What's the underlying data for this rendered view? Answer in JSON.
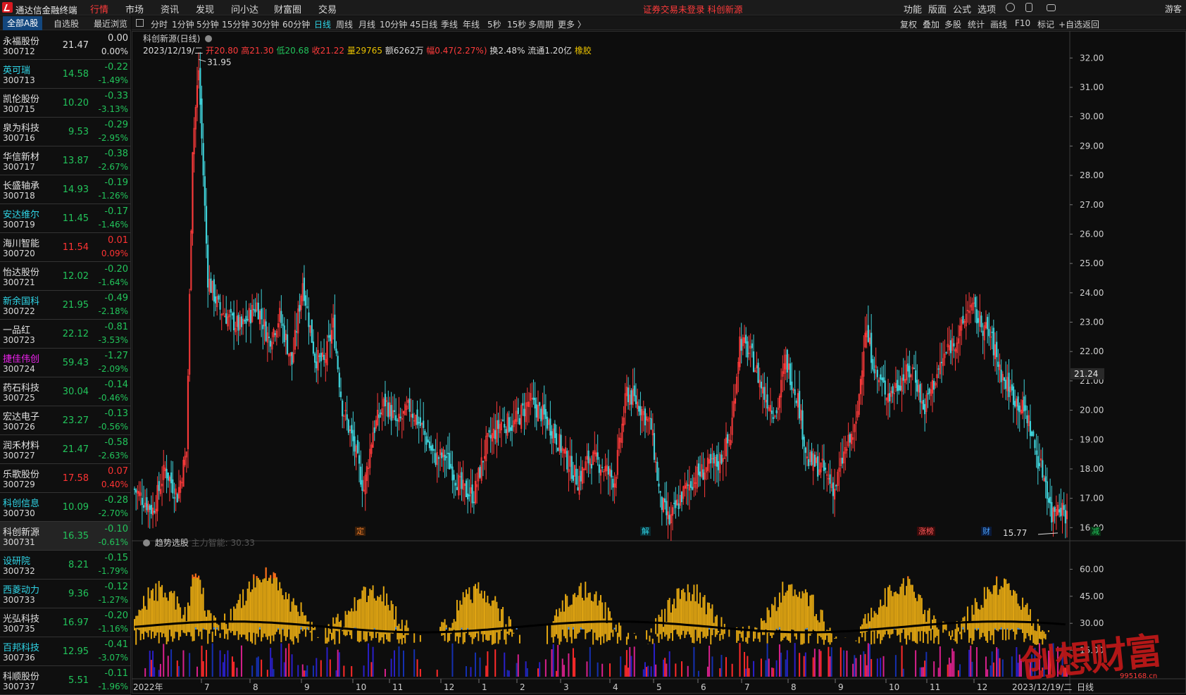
{
  "app": {
    "title": "通达信金融终端",
    "guest": "游客"
  },
  "top_menu": [
    "行情",
    "市场",
    "资讯",
    "发现",
    "问小达",
    "财富圈",
    "交易"
  ],
  "status_text": "证券交易未登录  科创新源",
  "right_menu": [
    "功能",
    "版面",
    "公式",
    "选项"
  ],
  "left_tabs": [
    "全部A股",
    "自选股",
    "最近浏览"
  ],
  "stocks": [
    {
      "name": "永福股份",
      "code": "300712",
      "price": "21.47",
      "chg": "0.00",
      "pct": "0.00%",
      "dir": "fl",
      "name_color": "w"
    },
    {
      "name": "英可瑞",
      "code": "300713",
      "price": "14.58",
      "chg": "-0.22",
      "pct": "-1.49%",
      "dir": "dn",
      "name_color": "cyan"
    },
    {
      "name": "凯伦股份",
      "code": "300715",
      "price": "10.20",
      "chg": "-0.33",
      "pct": "-3.13%",
      "dir": "dn",
      "name_color": "w"
    },
    {
      "name": "泉为科技",
      "code": "300716",
      "price": "9.53",
      "chg": "-0.29",
      "pct": "-2.95%",
      "dir": "dn",
      "name_color": "w"
    },
    {
      "name": "华信新材",
      "code": "300717",
      "price": "13.87",
      "chg": "-0.38",
      "pct": "-2.67%",
      "dir": "dn",
      "name_color": "w"
    },
    {
      "name": "长盛轴承",
      "code": "300718",
      "price": "14.93",
      "chg": "-0.19",
      "pct": "-1.26%",
      "dir": "dn",
      "name_color": "w"
    },
    {
      "name": "安达维尔",
      "code": "300719",
      "price": "11.45",
      "chg": "-0.17",
      "pct": "-1.46%",
      "dir": "dn",
      "name_color": "cyan"
    },
    {
      "name": "海川智能",
      "code": "300720",
      "price": "11.54",
      "chg": "0.01",
      "pct": "0.09%",
      "dir": "up",
      "name_color": "w"
    },
    {
      "name": "怡达股份",
      "code": "300721",
      "price": "12.02",
      "chg": "-0.20",
      "pct": "-1.64%",
      "dir": "dn",
      "name_color": "w"
    },
    {
      "name": "新余国科",
      "code": "300722",
      "price": "21.95",
      "chg": "-0.49",
      "pct": "-2.18%",
      "dir": "dn",
      "name_color": "cyan"
    },
    {
      "name": "一品红",
      "code": "300723",
      "price": "22.12",
      "chg": "-0.81",
      "pct": "-3.53%",
      "dir": "dn",
      "name_color": "w"
    },
    {
      "name": "捷佳伟创",
      "code": "300724",
      "price": "59.43",
      "chg": "-1.27",
      "pct": "-2.09%",
      "dir": "dn",
      "name_color": "mag"
    },
    {
      "name": "药石科技",
      "code": "300725",
      "price": "30.04",
      "chg": "-0.14",
      "pct": "-0.46%",
      "dir": "dn",
      "name_color": "w"
    },
    {
      "name": "宏达电子",
      "code": "300726",
      "price": "23.27",
      "chg": "-0.13",
      "pct": "-0.56%",
      "dir": "dn",
      "name_color": "w"
    },
    {
      "name": "润禾材料",
      "code": "300727",
      "price": "21.47",
      "chg": "-0.58",
      "pct": "-2.63%",
      "dir": "dn",
      "name_color": "w"
    },
    {
      "name": "乐歌股份",
      "code": "300729",
      "price": "17.58",
      "chg": "0.07",
      "pct": "0.40%",
      "dir": "up",
      "name_color": "w"
    },
    {
      "name": "科创信息",
      "code": "300730",
      "price": "10.09",
      "chg": "-0.28",
      "pct": "-2.70%",
      "dir": "dn",
      "name_color": "cyan"
    },
    {
      "name": "科创新源",
      "code": "300731",
      "price": "16.35",
      "chg": "-0.10",
      "pct": "-0.61%",
      "dir": "dn",
      "name_color": "w"
    },
    {
      "name": "设研院",
      "code": "300732",
      "price": "8.21",
      "chg": "-0.15",
      "pct": "-1.79%",
      "dir": "dn",
      "name_color": "cyan"
    },
    {
      "name": "西菱动力",
      "code": "300733",
      "price": "9.36",
      "chg": "-0.12",
      "pct": "-1.27%",
      "dir": "dn",
      "name_color": "cyan"
    },
    {
      "name": "光弘科技",
      "code": "300735",
      "price": "16.97",
      "chg": "-0.20",
      "pct": "-1.16%",
      "dir": "dn",
      "name_color": "w"
    },
    {
      "name": "百邦科技",
      "code": "300736",
      "price": "12.95",
      "chg": "-0.41",
      "pct": "-3.07%",
      "dir": "dn",
      "name_color": "cyan"
    },
    {
      "name": "科顺股份",
      "code": "300737",
      "price": "5.51",
      "chg": "-0.11",
      "pct": "-1.96%",
      "dir": "dn",
      "name_color": "w"
    }
  ],
  "period_items": [
    "分时",
    "1分钟",
    "5分钟",
    "15分钟",
    "30分钟",
    "60分钟",
    "日线",
    "周线",
    "月线",
    "10分钟",
    "45日线",
    "季线",
    "年线",
    "5秒",
    "15秒",
    "多周期",
    "更多 〉"
  ],
  "period_active": "日线",
  "right_tools": [
    "复权",
    "叠加",
    "多股",
    "统计",
    "画线",
    "F10",
    "标记",
    "+自选",
    "返回"
  ],
  "chart_header": {
    "title": "科创新源(日线)",
    "date": "2023/12/19/二",
    "open_label": "开",
    "open": "20.80",
    "high_label": "高",
    "high": "21.30",
    "low_label": "低",
    "low": "20.68",
    "close_label": "收",
    "close": "21.22",
    "vol_label": "量",
    "vol": "29765",
    "amt_label": "额",
    "amt": "6262万",
    "range_label": "幅",
    "range": "0.47(2.27%)",
    "turn_label": "换",
    "turn": "2.48%",
    "float_label": "流通",
    "float": "1.20亿",
    "sector": "橡胶"
  },
  "indicator": {
    "title": "趋势选股",
    "subtitle": "主力智能: 30.33"
  },
  "chart_data": {
    "type": "candlestick",
    "title": "科创新源(日线)",
    "y_ticks": [
      "32.00",
      "31.00",
      "30.00",
      "29.00",
      "28.00",
      "27.00",
      "26.00",
      "25.00",
      "24.00",
      "23.00",
      "22.00",
      "21.00",
      "20.00",
      "19.00",
      "18.00",
      "17.00",
      "16.00"
    ],
    "ylim": [
      15.6,
      32.2
    ],
    "current_price": "21.24",
    "max_label": "31.95",
    "min_label": "15.77",
    "x_labels": [
      "2022年",
      "7",
      "8",
      "9",
      "10",
      "11",
      "12",
      "1",
      "2",
      "3",
      "4",
      "5",
      "6",
      "7",
      "8",
      "9",
      "10",
      "11",
      "12",
      "2023/12/19/二"
    ],
    "x_label_right": "日线",
    "event_markers": [
      "定",
      "解",
      "涨榜",
      "财",
      "减"
    ],
    "close_path": [
      [
        0,
        17.3
      ],
      [
        12,
        16.6
      ],
      [
        20,
        18.0
      ],
      [
        28,
        17.1
      ],
      [
        34,
        18.6
      ],
      [
        38,
        29.0
      ],
      [
        42,
        31.6
      ],
      [
        48,
        24.5
      ],
      [
        55,
        23.5
      ],
      [
        62,
        23.1
      ],
      [
        70,
        22.8
      ],
      [
        80,
        23.6
      ],
      [
        88,
        22.4
      ],
      [
        95,
        23.2
      ],
      [
        103,
        21.6
      ],
      [
        110,
        24.4
      ],
      [
        118,
        21.8
      ],
      [
        124,
        21.6
      ],
      [
        130,
        22.9
      ],
      [
        136,
        20.1
      ],
      [
        143,
        18.9
      ],
      [
        150,
        17.3
      ],
      [
        156,
        19.3
      ],
      [
        164,
        20.3
      ],
      [
        172,
        19.5
      ],
      [
        180,
        20.1
      ],
      [
        188,
        19.4
      ],
      [
        196,
        18.4
      ],
      [
        204,
        18.4
      ],
      [
        214,
        17.3
      ],
      [
        222,
        17.1
      ],
      [
        230,
        18.8
      ],
      [
        240,
        19.6
      ],
      [
        248,
        19.5
      ],
      [
        258,
        20.3
      ],
      [
        266,
        19.9
      ],
      [
        274,
        19.3
      ],
      [
        282,
        18.4
      ],
      [
        290,
        17.6
      ],
      [
        298,
        18.4
      ],
      [
        306,
        18.1
      ],
      [
        314,
        17.6
      ],
      [
        322,
        20.6
      ],
      [
        330,
        20.2
      ],
      [
        338,
        19.4
      ],
      [
        344,
        16.9
      ],
      [
        350,
        16.2
      ],
      [
        358,
        17.1
      ],
      [
        366,
        17.7
      ],
      [
        374,
        18.0
      ],
      [
        382,
        18.2
      ],
      [
        390,
        19.1
      ],
      [
        396,
        22.4
      ],
      [
        404,
        21.8
      ],
      [
        412,
        20.5
      ],
      [
        420,
        19.9
      ],
      [
        426,
        21.7
      ],
      [
        434,
        20.4
      ],
      [
        440,
        18.3
      ],
      [
        450,
        18.0
      ],
      [
        458,
        17.3
      ],
      [
        464,
        18.5
      ],
      [
        472,
        19.4
      ],
      [
        478,
        22.8
      ],
      [
        486,
        21.1
      ],
      [
        494,
        20.5
      ],
      [
        502,
        21.1
      ],
      [
        510,
        21.4
      ],
      [
        516,
        20.0
      ],
      [
        524,
        21.1
      ],
      [
        532,
        22.1
      ],
      [
        540,
        22.6
      ],
      [
        546,
        23.6
      ],
      [
        552,
        23.1
      ],
      [
        560,
        22.5
      ],
      [
        568,
        21.1
      ],
      [
        576,
        20.4
      ],
      [
        584,
        19.8
      ],
      [
        590,
        18.5
      ],
      [
        596,
        17.6
      ],
      [
        600,
        16.4
      ],
      [
        604,
        16.9
      ],
      [
        610,
        16.4
      ]
    ],
    "close_path_x_max": 610
  }
}
